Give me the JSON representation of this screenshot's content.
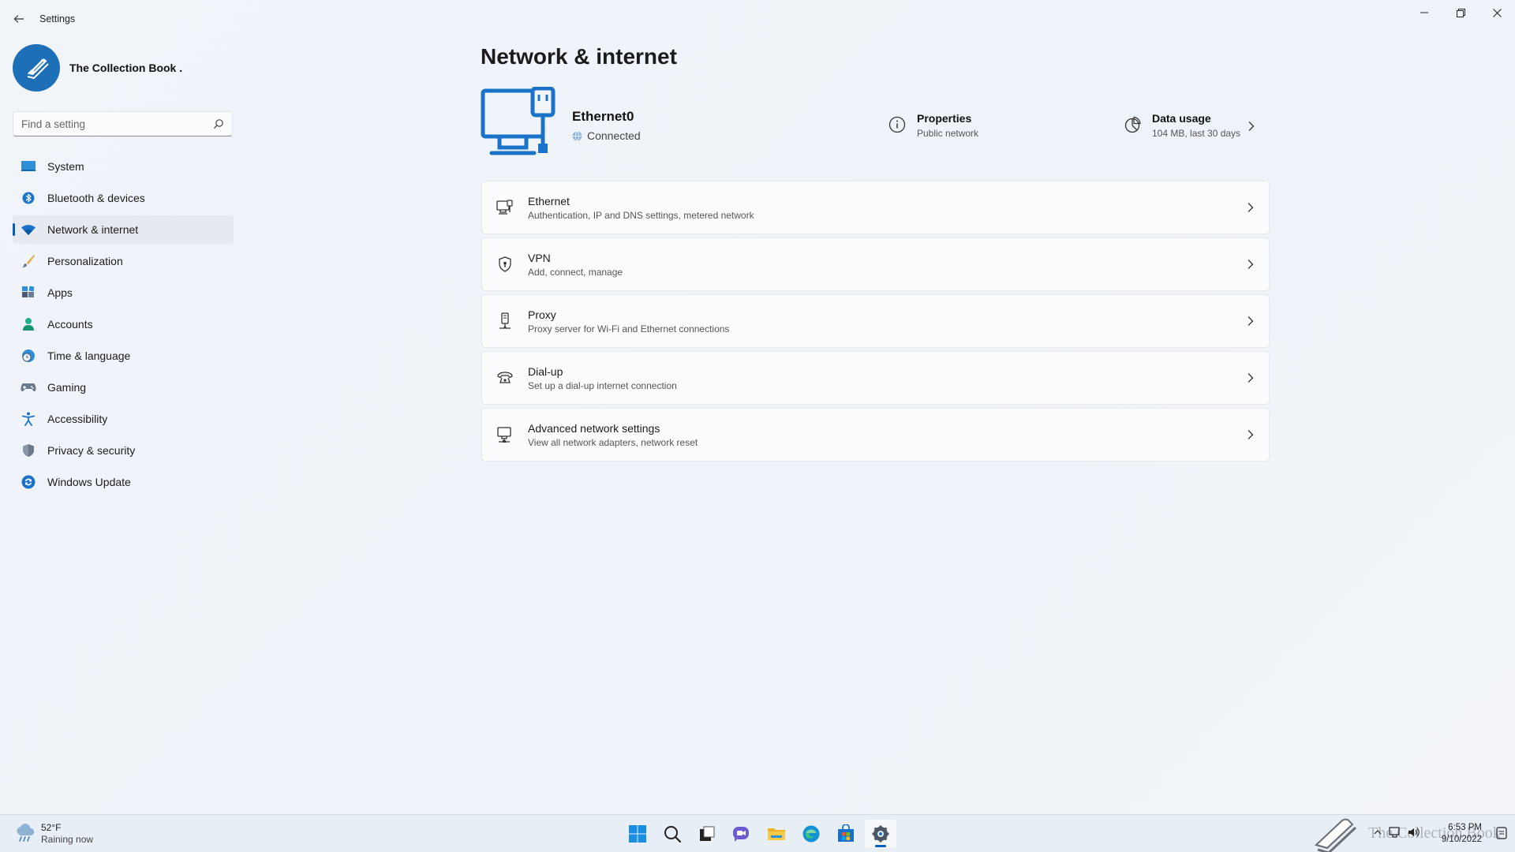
{
  "window": {
    "title": "Settings",
    "controls": [
      "minimize",
      "restore",
      "close"
    ]
  },
  "profile": {
    "name": "The Collection Book ."
  },
  "search": {
    "placeholder": "Find a setting"
  },
  "sidebar": {
    "items": [
      {
        "label": "System",
        "icon": "system-icon",
        "active": false
      },
      {
        "label": "Bluetooth & devices",
        "icon": "bluetooth-icon",
        "active": false
      },
      {
        "label": "Network & internet",
        "icon": "wifi-icon",
        "active": true
      },
      {
        "label": "Personalization",
        "icon": "brush-icon",
        "active": false
      },
      {
        "label": "Apps",
        "icon": "apps-icon",
        "active": false
      },
      {
        "label": "Accounts",
        "icon": "person-icon",
        "active": false
      },
      {
        "label": "Time & language",
        "icon": "globe-clock-icon",
        "active": false
      },
      {
        "label": "Gaming",
        "icon": "gamepad-icon",
        "active": false
      },
      {
        "label": "Accessibility",
        "icon": "accessibility-icon",
        "active": false
      },
      {
        "label": "Privacy & security",
        "icon": "shield-icon",
        "active": false
      },
      {
        "label": "Windows Update",
        "icon": "update-icon",
        "active": false
      }
    ]
  },
  "main": {
    "title": "Network & internet",
    "connection": {
      "name": "Ethernet0",
      "status": "Connected"
    },
    "properties": {
      "title": "Properties",
      "subtitle": "Public network"
    },
    "data_usage": {
      "title": "Data usage",
      "subtitle": "104 MB, last 30 days"
    },
    "cards": [
      {
        "title": "Ethernet",
        "subtitle": "Authentication, IP and DNS settings, metered network",
        "icon": "ethernet-icon"
      },
      {
        "title": "VPN",
        "subtitle": "Add, connect, manage",
        "icon": "vpn-shield-icon"
      },
      {
        "title": "Proxy",
        "subtitle": "Proxy server for Wi-Fi and Ethernet connections",
        "icon": "proxy-icon"
      },
      {
        "title": "Dial-up",
        "subtitle": "Set up a dial-up internet connection",
        "icon": "dialup-icon"
      },
      {
        "title": "Advanced network settings",
        "subtitle": "View all network adapters, network reset",
        "icon": "advanced-network-icon"
      }
    ]
  },
  "taskbar": {
    "weather": {
      "temp": "52°F",
      "condition": "Raining now"
    },
    "apps": [
      "start-icon",
      "search-icon",
      "task-view-icon",
      "chat-icon",
      "file-explorer-icon",
      "edge-icon",
      "store-icon",
      "settings-icon"
    ],
    "watermark": "The Collection Book",
    "time": "6:53 PM",
    "date": "9/10/2022"
  },
  "colors": {
    "accent": "#005fb8",
    "hero_blue": "#1a73c8"
  }
}
